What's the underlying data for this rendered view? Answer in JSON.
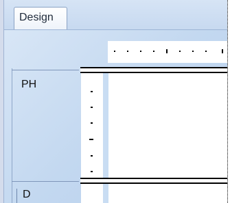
{
  "tabs": [
    {
      "label": "Design",
      "active": true
    }
  ],
  "sections": {
    "page_header": {
      "label": "PH"
    },
    "detail": {
      "label": "D"
    }
  },
  "colors": {
    "panel_background": "#c9ddf3",
    "canvas": "#ffffff",
    "band_border": "#000000"
  }
}
